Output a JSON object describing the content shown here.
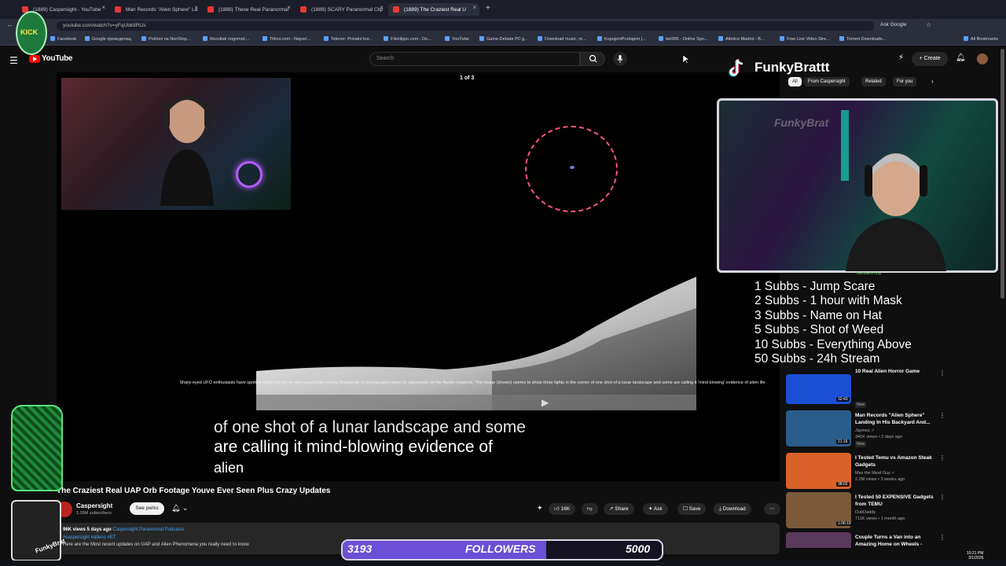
{
  "browser": {
    "tabs": [
      {
        "label": "(1889) Caspersight - YouTube"
      },
      {
        "label": "Man Records \"Alien Sphere\" La"
      },
      {
        "label": "(1889) These Real Paranormal"
      },
      {
        "label": "(1889) SCARY Paranormal Clip"
      },
      {
        "label": "(1889) The Craziest Real U"
      }
    ],
    "new_tab": "+",
    "url": "youtube.com/watch?v=yFqUbk8RtJs",
    "ask_google": "Ask Google",
    "bookmarks": [
      "Facebook",
      "Google преводилац",
      "Pokloni na NonStop...",
      "Rezultati nogomet,...",
      "Titlovi.com - Najveć...",
      "Telenor: Privatni kor...",
      "FileHippo.com - Do...",
      "YouTube",
      "Game-Debate PC g...",
      "Download music, m...",
      "KupujemProdajem |...",
      "bet365 - Online Spo...",
      "Atletico Madrid - B...",
      "Free Live Video Stre...",
      "Torrent Downloads..."
    ],
    "all_bookmarks": "All Bookmarks"
  },
  "youtube": {
    "logo": "YouTube",
    "search_placeholder": "Search",
    "create_label": "Create",
    "chips": [
      "All",
      "From Caspersight",
      "Related",
      "For you"
    ]
  },
  "video": {
    "counter": "1 of 3",
    "caption_small": "Sharp-eyed UFO enthusiasts have spotted what may be an alien spaceship among thousands of photographs taken by astronauts on the Apollo missions. The image (shown) seems to show three lights in the corner of one shot of a lunar landscape and some are calling it 'mind blowing' evidence of alien life",
    "subtitle_line1": "of one shot of a lunar landscape and some",
    "subtitle_line2": "are calling it mind-blowing evidence of",
    "subtitle_line3": "alien",
    "title": "The Craziest Real UAP Orb Footage Youve Ever Seen Plus Crazy Updates"
  },
  "channel": {
    "name": "Caspersight",
    "subs": "1.09M subscribers",
    "see_perks": "See perks"
  },
  "actions": {
    "likes": "16K",
    "share": "Share",
    "ask": "Ask",
    "save": "Save",
    "download": "Download"
  },
  "description": {
    "meta": "96K views  5 days ago",
    "playlist": "Caspersight Paranormal Podcasts",
    "tags": "#caspersight #aliens #ET",
    "text": "Here are the Most recent updates on UAP and Alien Phenomena you really need to know"
  },
  "stream": {
    "name": "FunkyBrattt",
    "cam_logo": "FunkyBrat",
    "logo_text": "KICK",
    "badge_text": "FunkyBrat",
    "members_only": "Members only",
    "sub_goals": [
      "1 Subbs - Jump Scare",
      "2 Subbs - 1 hour with Mask",
      "3 Subbs - Name on Hat",
      "5 Subbs - Shot of Weed",
      "10 Subbs - Everything Above",
      "50 Subbs - 24h Stream"
    ],
    "followers_current": "3193",
    "followers_label": "FOLLOWERS",
    "followers_goal": "5000",
    "followers_progress": 0.6386
  },
  "recommendations": [
    {
      "title": "10 Real Alien Horror Game",
      "meta": "",
      "duration": "32:43",
      "new": "New",
      "color": "#1b4fd6"
    },
    {
      "title": "Man Records \"Alien Sphere\" Landing In His Backyard And...",
      "meta": "Jaymez ✓\n341K views • 2 days ago",
      "duration": "21:16",
      "new": "New",
      "color": "#2a5c8a"
    },
    {
      "title": "I Tested Temu vs Amazon Steak Gadgets",
      "meta": "Max the Meat Guy ✓\n2.2M views • 3 weeks ago",
      "duration": "38:02",
      "new": "",
      "color": "#d8622a"
    },
    {
      "title": "I Tested 50 EXPENSIVE Gadgets from TEMU",
      "meta": "DubDaddy\n711K views • 1 month ago",
      "duration": "1:06:19",
      "new": "",
      "color": "#7a5a3a"
    },
    {
      "title": "Couple Turns a Van into an Amazing Home on Wheels -",
      "meta": "",
      "duration": "",
      "new": "",
      "color": "#5a3a5a"
    }
  ],
  "system": {
    "time": "10:21 PM",
    "date": "3/1/2026"
  }
}
